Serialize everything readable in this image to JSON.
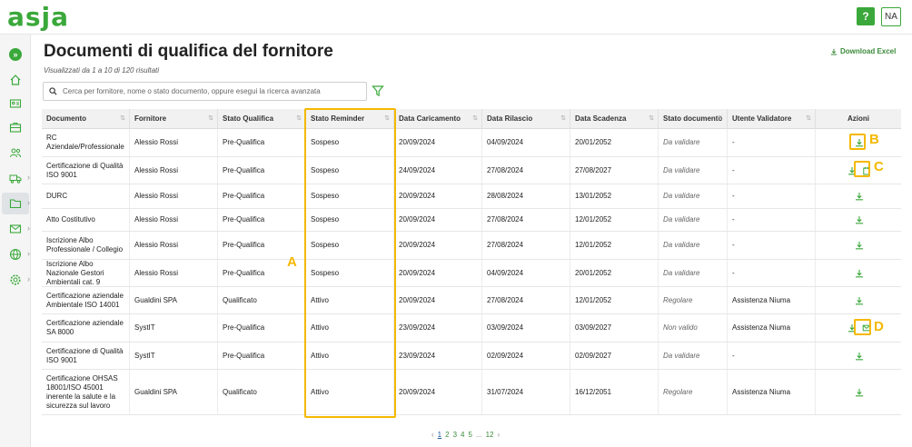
{
  "app": {
    "logo": "asja"
  },
  "header": {
    "help_label": "?",
    "avatar_initials": "NA"
  },
  "page": {
    "title": "Documenti di qualifica del fornitore",
    "result_count": "Visualizzati da 1 a 10 di 120 risultati",
    "download_label": "Download Excel"
  },
  "search": {
    "placeholder": "Cerca per fornitore, nome o stato documento, oppure esegui la ricerca avanzata",
    "value": ""
  },
  "table": {
    "columns": [
      "Documento",
      "Fornitore",
      "Stato Qualifica",
      "Stato Reminder",
      "Data Caricamento",
      "Data Rilascio",
      "Data Scadenza",
      "Stato documento",
      "Utente Validatore",
      "Azioni"
    ],
    "rows": [
      [
        "RC Aziendale/Professionale",
        "Alessio Rossi",
        "Pre-Qualifica",
        "Sospeso",
        "20/09/2024",
        "04/09/2024",
        "20/01/2052",
        "Da validare",
        "-"
      ],
      [
        "Certificazione di Qualità ISO 9001",
        "Alessio Rossi",
        "Pre-Qualifica",
        "Sospeso",
        "24/09/2024",
        "27/08/2024",
        "27/08/2027",
        "Da validare",
        "-"
      ],
      [
        "DURC",
        "Alessio Rossi",
        "Pre-Qualifica",
        "Sospeso",
        "20/09/2024",
        "28/08/2024",
        "13/01/2052",
        "Da validare",
        "-"
      ],
      [
        "Atto Costitutivo",
        "Alessio Rossi",
        "Pre-Qualifica",
        "Sospeso",
        "20/09/2024",
        "27/08/2024",
        "12/01/2052",
        "Da validare",
        "-"
      ],
      [
        "Iscrizione Albo Professionale / Collegio",
        "Alessio Rossi",
        "Pre-Qualifica",
        "Sospeso",
        "20/09/2024",
        "27/08/2024",
        "12/01/2052",
        "Da validare",
        "-"
      ],
      [
        "Iscrizione Albo Nazionale Gestori Ambientali cat. 9",
        "Alessio Rossi",
        "Pre-Qualifica",
        "Sospeso",
        "20/09/2024",
        "04/09/2024",
        "20/01/2052",
        "Da validare",
        "-"
      ],
      [
        "Certificazione aziendale Ambientale ISO 14001",
        "Gualdini SPA",
        "Qualificato",
        "Attivo",
        "20/09/2024",
        "27/08/2024",
        "12/01/2052",
        "Regolare",
        "Assistenza Niuma"
      ],
      [
        "Certificazione aziendale SA 8000",
        "SystIT",
        "Pre-Qualifica",
        "Attivo",
        "23/09/2024",
        "03/09/2024",
        "03/09/2027",
        "Non valido",
        "Assistenza Niuma"
      ],
      [
        "Certificazione di Qualità ISO 9001",
        "SystIT",
        "Pre-Qualifica",
        "Attivo",
        "23/09/2024",
        "02/09/2024",
        "02/09/2027",
        "Da validare",
        "-"
      ],
      [
        "Certificazione OHSAS 18001/ISO 45001 inerente la salute e la sicurezza sul lavoro",
        "Gualdini SPA",
        "Qualificato",
        "Attivo",
        "20/09/2024",
        "31/07/2024",
        "16/12/2051",
        "Regolare",
        "Assistenza Niuma"
      ]
    ]
  },
  "annotations": {
    "a": "A",
    "b": "B",
    "c": "C",
    "d": "D"
  },
  "pagination": {
    "pages": [
      "1",
      "2",
      "3",
      "4",
      "5",
      "...",
      "12"
    ],
    "prev": "‹",
    "next": "›"
  },
  "colors": {
    "accent": "#3aa83a",
    "highlight": "#f5b800"
  },
  "icons": [
    "expand-icon",
    "home-icon",
    "id-card-icon",
    "briefcase-icon",
    "users-icon",
    "truck-icon",
    "folder-icon",
    "mail-icon",
    "globe-icon",
    "settings-icon",
    "search-icon",
    "filter-icon",
    "download-icon",
    "calendar-icon",
    "envelope-icon"
  ]
}
